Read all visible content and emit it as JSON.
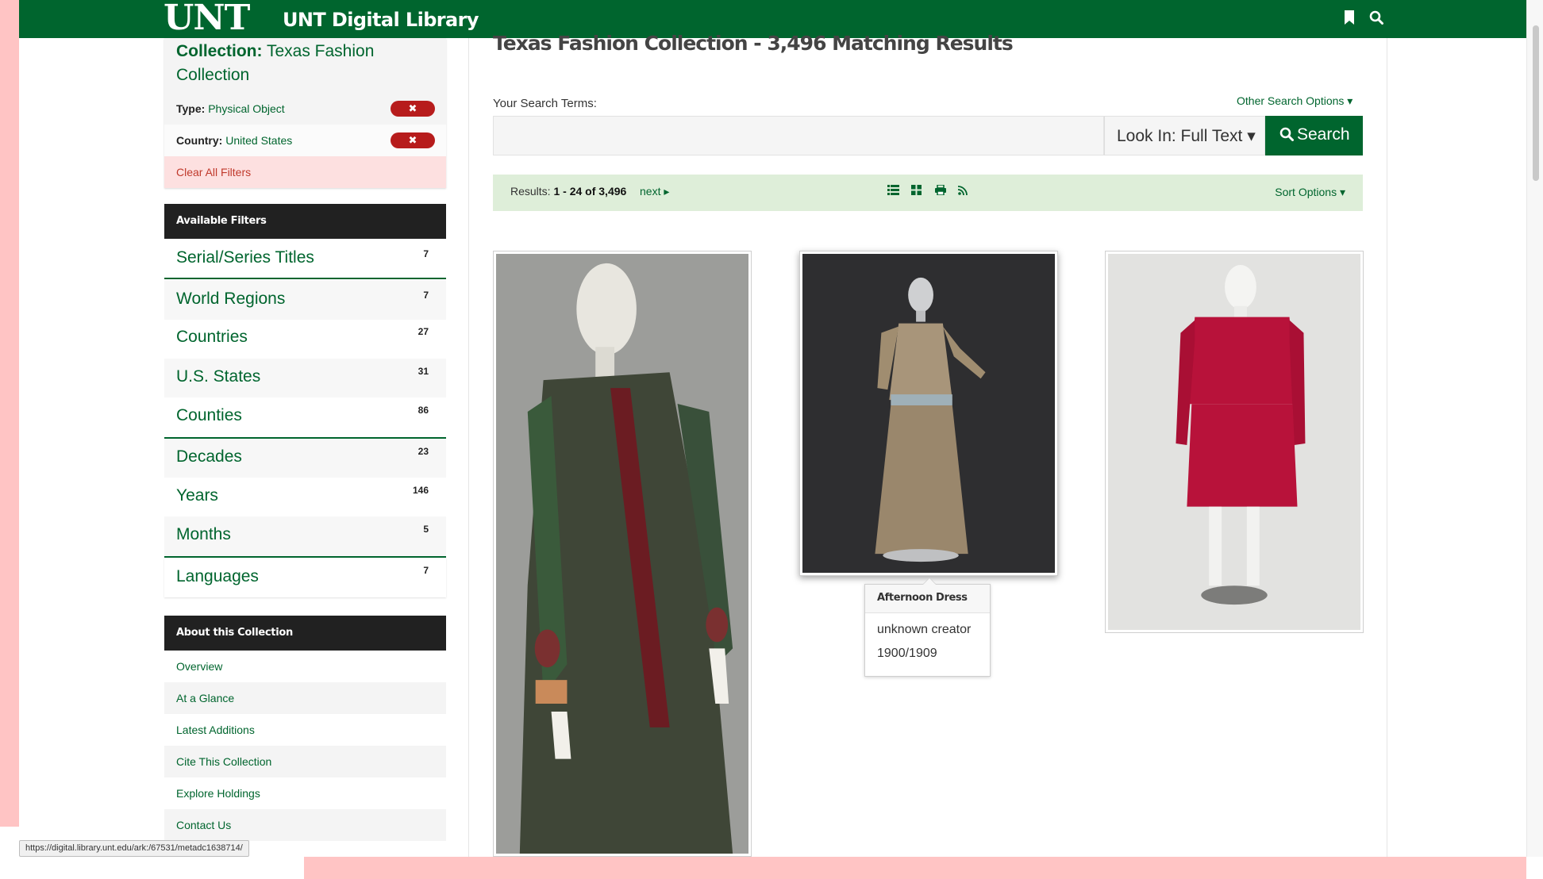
{
  "header": {
    "logo": "UNT",
    "site_name": "UNT Digital Library",
    "bookmark_icon": "bookmark-icon",
    "search_icon": "search-icon"
  },
  "sidebar": {
    "collection_label": "Collection:",
    "collection_name": "Texas Fashion Collection",
    "active_filters": [
      {
        "label": "Type:",
        "value": "Physical Object",
        "remove": "✖"
      },
      {
        "label": "Country:",
        "value": "United States",
        "remove": "✖"
      }
    ],
    "clear_all": "Clear All Filters",
    "available_filters_title": "Available Filters",
    "facets": [
      {
        "name": "Serial/Series Titles",
        "count": "7"
      },
      {
        "name": "World Regions",
        "count": "7"
      },
      {
        "name": "Countries",
        "count": "27"
      },
      {
        "name": "U.S. States",
        "count": "31"
      },
      {
        "name": "Counties",
        "count": "86"
      },
      {
        "name": "Decades",
        "count": "23"
      },
      {
        "name": "Years",
        "count": "146"
      },
      {
        "name": "Months",
        "count": "5"
      },
      {
        "name": "Languages",
        "count": "7"
      }
    ],
    "about_title": "About this Collection",
    "about_links": [
      "Overview",
      "At a Glance",
      "Latest Additions",
      "Cite This Collection",
      "Explore Holdings",
      "Contact Us"
    ]
  },
  "main": {
    "heading": "Texas Fashion Collection - 3,496 Matching Results",
    "search_label": "Your Search Terms:",
    "other_options": "Other Search Options ▾",
    "search_value": "",
    "look_in": "Look In: Full Text ▾",
    "search_button": "Search",
    "results_prefix": "Results:",
    "results_range": "1 - 24 of 3,496",
    "next": "next ▸",
    "sort_options": "Sort Options ▾"
  },
  "tooltip": {
    "title": "Afternoon Dress",
    "creator": "unknown creator",
    "date": "1900/1909"
  },
  "status_bar": {
    "url": "https://digital.library.unt.edu/ark:/67531/metadc1638714/"
  },
  "colors": {
    "brand_green": "#00652e",
    "results_bar": "#deeed9",
    "remove_red": "#b71c1c",
    "page_edge_pink": "#ffc4c4"
  }
}
